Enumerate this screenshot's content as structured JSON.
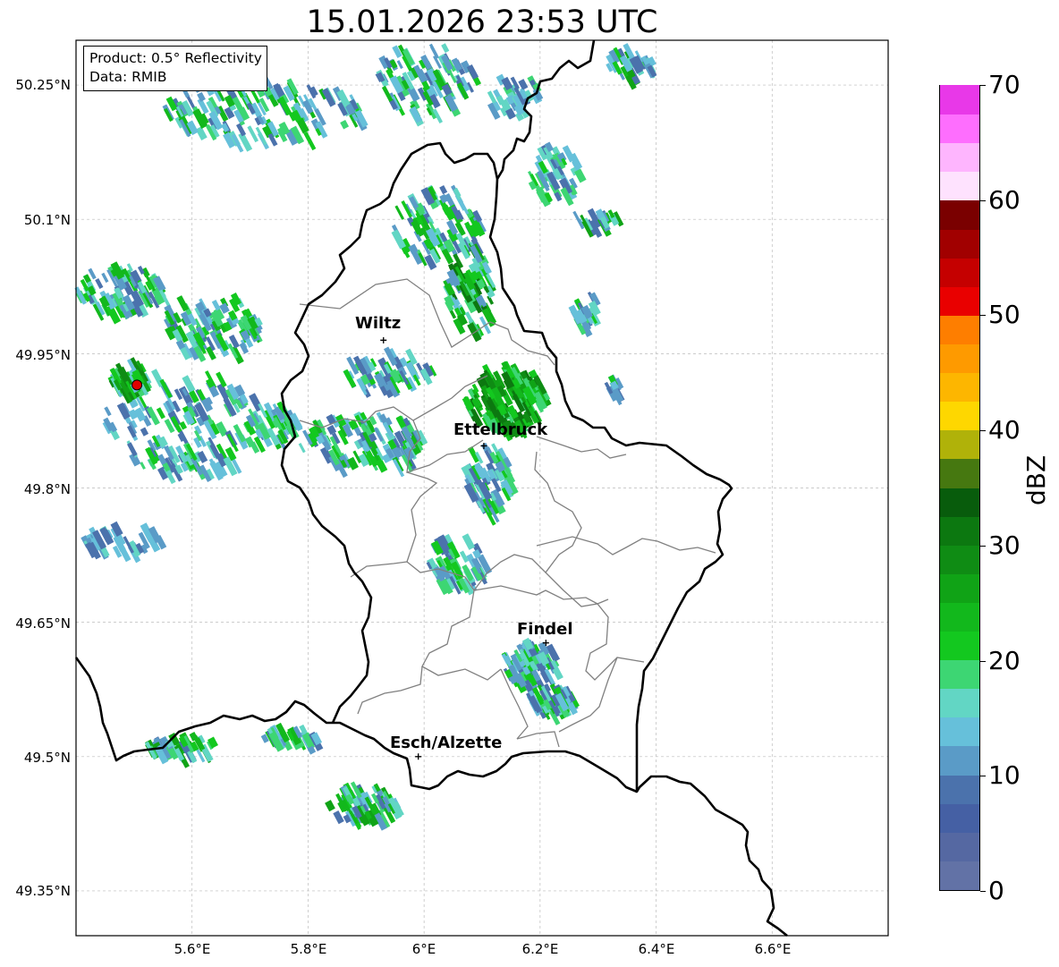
{
  "title": "15.01.2026 23:53 UTC",
  "info": {
    "product": "Product: 0.5° Reflectivity",
    "source": "Data: RMIB"
  },
  "lat_labels": [
    "50.25°N",
    "50.1°N",
    "49.95°N",
    "49.8°N",
    "49.65°N",
    "49.5°N",
    "49.35°N"
  ],
  "lon_labels": [
    "5.6°E",
    "5.8°E",
    "6°E",
    "6.2°E",
    "6.4°E",
    "6.6°E"
  ],
  "cities": [
    {
      "name": "Wiltz",
      "lon": 5.93,
      "lat": 49.965
    },
    {
      "name": "Ettelbruck",
      "lon": 6.103,
      "lat": 49.847
    },
    {
      "name": "Findel",
      "lon": 6.21,
      "lat": 49.627
    },
    {
      "name": "Esch/Alzette",
      "lon": 5.99,
      "lat": 49.5
    }
  ],
  "radar_site": {
    "lon": 5.505,
    "lat": 49.915,
    "color": "#e00000"
  },
  "map_extent": {
    "lon": [
      5.4,
      6.8
    ],
    "lat": [
      49.3,
      50.3
    ]
  },
  "colorbar": {
    "label": "dBZ",
    "min": 0,
    "max": 70,
    "ticks": [
      "0",
      "10",
      "20",
      "30",
      "40",
      "50",
      "60",
      "70"
    ],
    "colors": [
      "#6272a6",
      "#5568a2",
      "#4560a4",
      "#4b72ac",
      "#5a9bc7",
      "#66c0da",
      "#62d6c4",
      "#3dd673",
      "#13c81f",
      "#12b81c",
      "#10a316",
      "#0f8c14",
      "#0c7810",
      "#085c0c",
      "#467810",
      "#b0b209",
      "#fed700",
      "#fdb600",
      "#fe9a00",
      "#fe7e00",
      "#e90000",
      "#c50000",
      "#a10000",
      "#7a0000",
      "#fee2fe",
      "#feb5fe",
      "#fe6efe",
      "#e838e8"
    ]
  }
}
